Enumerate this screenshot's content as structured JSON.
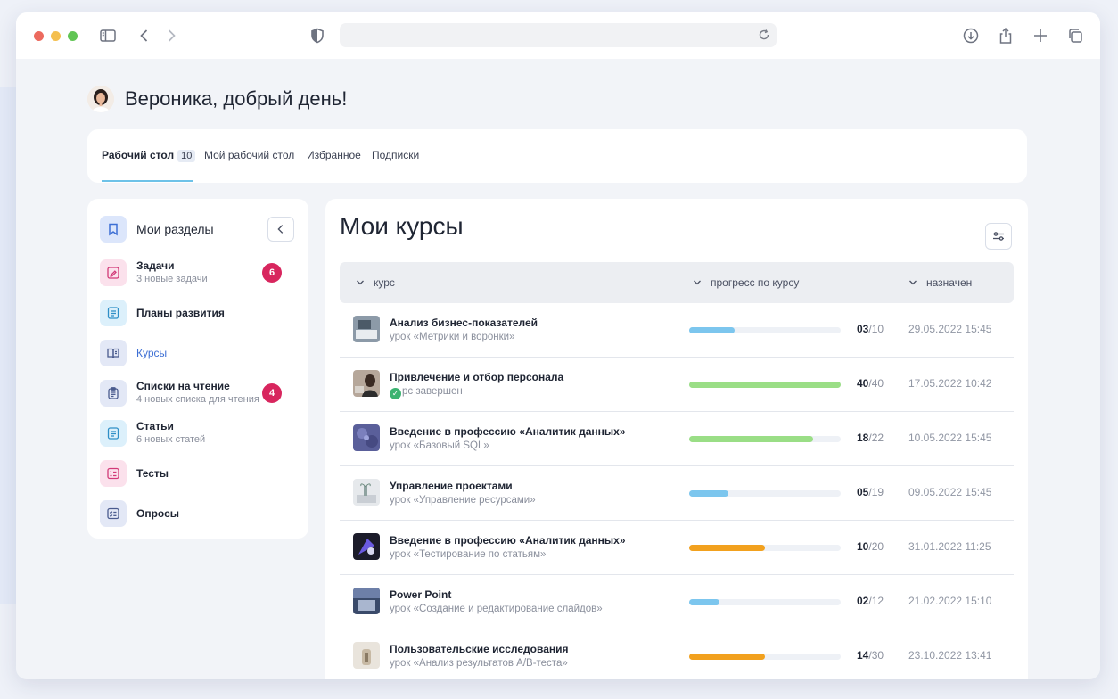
{
  "greeting": "Вероника, добрый день!",
  "tabs": [
    {
      "label": "Рабочий стол",
      "count": "10"
    },
    {
      "label": "Мой рабочий стол"
    },
    {
      "label": "Избранное"
    },
    {
      "label": "Подписки"
    }
  ],
  "sidebar": {
    "title": "Мои разделы",
    "items": [
      {
        "label": "Задачи",
        "sub": "3 новые задачи",
        "badge": "6",
        "icon": "pencil-icon"
      },
      {
        "label": "Планы развития",
        "icon": "document-icon"
      },
      {
        "label": "Курсы",
        "icon": "book-icon"
      },
      {
        "label": "Списки на чтение",
        "sub": "4 новых списка для чтения",
        "badge": "4",
        "icon": "clipboard-icon"
      },
      {
        "label": "Статьи",
        "sub": "6 новых статей",
        "icon": "article-icon"
      },
      {
        "label": "Тесты",
        "icon": "test-icon"
      },
      {
        "label": "Опросы",
        "icon": "checklist-icon"
      }
    ]
  },
  "main": {
    "title": "Мои курсы",
    "columns": [
      "курс",
      "прогресс по курсу",
      "назначен"
    ],
    "rows": [
      {
        "name": "Анализ бизнес-показателей",
        "sub": "урок «Метрики и воронки»",
        "done": "03",
        "total": "10",
        "progress": 0.3,
        "bar_color": "#7cc6ee",
        "date": "29.05.2022  15:45"
      },
      {
        "name": "Привлечение и отбор персонала",
        "sub": "рс завершен",
        "done": "40",
        "total": "40",
        "progress": 1.0,
        "bar_color": "#9ade86",
        "date": "17.05.2022  10:42",
        "completed": true
      },
      {
        "name": "Введение в профессию «Аналитик данных»",
        "sub": "урок «Базовый SQL»",
        "done": "18",
        "total": "22",
        "progress": 0.82,
        "bar_color": "#9ade86",
        "date": "10.05.2022  15:45"
      },
      {
        "name": "Управление проектами",
        "sub": "урок «Управление ресурсами»",
        "done": "05",
        "total": "19",
        "progress": 0.26,
        "bar_color": "#7cc6ee",
        "date": "09.05.2022  15:45"
      },
      {
        "name": "Введение в профессию «Аналитик данных»",
        "sub": "урок «Тестирование по статьям»",
        "done": "10",
        "total": "20",
        "progress": 0.5,
        "bar_color": "#f2a11e",
        "date": "31.01.2022  11:25"
      },
      {
        "name": "Power Point",
        "sub": "урок «Создание и редактирование слайдов»",
        "done": "02",
        "total": "12",
        "progress": 0.2,
        "bar_color": "#7cc6ee",
        "date": "21.02.2022  15:10"
      },
      {
        "name": "Пользовательские исследования",
        "sub": "урок «Анализ результатов A/B-теста»",
        "done": "14",
        "total": "30",
        "progress": 0.5,
        "bar_color": "#f2a11e",
        "date": "23.10.2022  13:41"
      }
    ]
  }
}
